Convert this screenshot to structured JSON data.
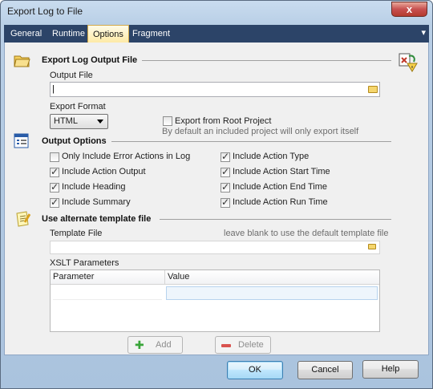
{
  "window": {
    "title": "Export Log to File",
    "close_glyph": "x"
  },
  "tabs": [
    {
      "label": "General"
    },
    {
      "label": "Runtime"
    },
    {
      "label": "Options"
    },
    {
      "label": "Fragment"
    }
  ],
  "tab_menu_glyph": "▾",
  "export_section": {
    "title": "Export Log Output File",
    "output_file_label": "Output File",
    "output_file_value": "",
    "export_format_label": "Export Format",
    "export_format_value": "HTML",
    "export_root_label": "Export from Root Project",
    "export_root_checked": false,
    "export_root_hint": "By default an included project will only export itself"
  },
  "output_options": {
    "title": "Output Options",
    "left": [
      {
        "label": "Only Include Error Actions in Log",
        "checked": false
      },
      {
        "label": "Include Action Output",
        "checked": true
      },
      {
        "label": "Include Heading",
        "checked": true
      },
      {
        "label": "Include Summary",
        "checked": true
      }
    ],
    "right": [
      {
        "label": "Include Action Type",
        "checked": true
      },
      {
        "label": "Include Action Start Time",
        "checked": true
      },
      {
        "label": "Include Action End Time",
        "checked": true
      },
      {
        "label": "Include Action Run Time",
        "checked": true
      }
    ]
  },
  "template_section": {
    "title": "Use alternate template file",
    "template_file_label": "Template File",
    "template_hint": "leave blank to use the default template file",
    "template_file_value": "",
    "xslt_label": "XSLT Parameters",
    "columns": [
      "Parameter",
      "Value"
    ],
    "add_label": "Add",
    "delete_label": "Delete"
  },
  "footer": {
    "ok": "OK",
    "cancel": "Cancel",
    "help": "Help"
  },
  "colors": {
    "tab_strip": "#2c4468",
    "active_tab": "#fdeaa6",
    "window_frame": "#b9cfe6"
  }
}
